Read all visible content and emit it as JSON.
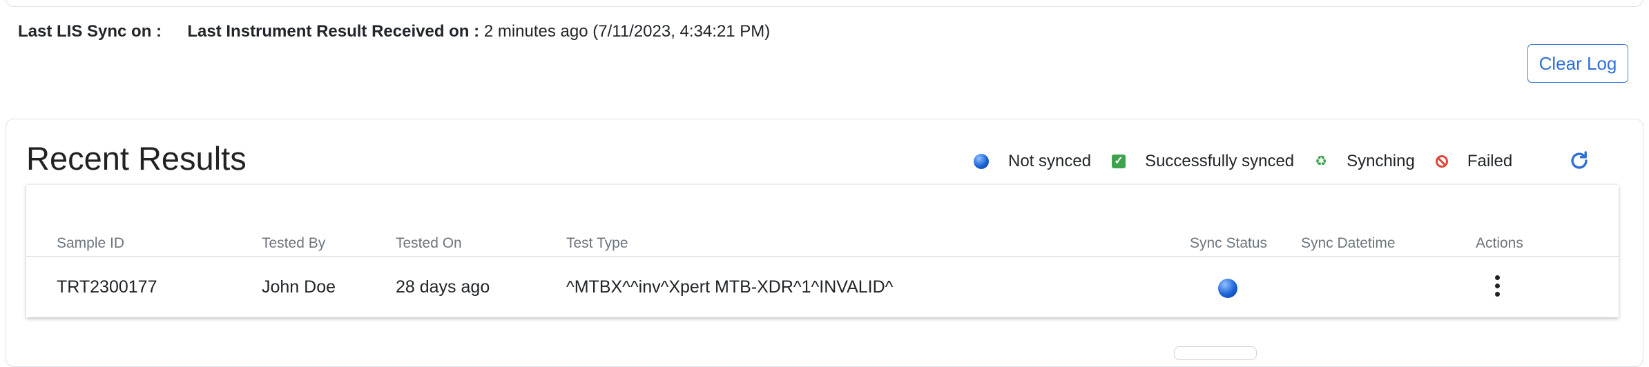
{
  "sync_info": {
    "lis_label": "Last LIS Sync on :",
    "instrument_label": "Last Instrument Result Received on :",
    "instrument_value": "2 minutes ago (7/11/2023, 4:34:21 PM)"
  },
  "actions": {
    "clear_log": "Clear Log"
  },
  "results": {
    "title": "Recent Results",
    "legend": [
      {
        "icon": "blue-dot-icon",
        "label": "Not synced"
      },
      {
        "icon": "check-box-icon",
        "label": "Successfully synced"
      },
      {
        "icon": "recycle-icon",
        "label": "Synching"
      },
      {
        "icon": "prohibited-icon",
        "label": "Failed"
      }
    ],
    "columns": [
      "Sample ID",
      "Tested By",
      "Tested On",
      "Test Type",
      "Sync Status",
      "Sync Datetime",
      "Actions"
    ],
    "rows": [
      {
        "sample_id": "TRT2300177",
        "tested_by": "John Doe",
        "tested_on": "28 days ago",
        "test_type": "^MTBX^^inv^Xpert MTB-XDR^1^INVALID^",
        "sync_status": "Not synced",
        "sync_datetime": ""
      }
    ]
  },
  "colors": {
    "accent": "#2f6fd5",
    "success": "#3fa34d",
    "danger": "#e0463b"
  }
}
